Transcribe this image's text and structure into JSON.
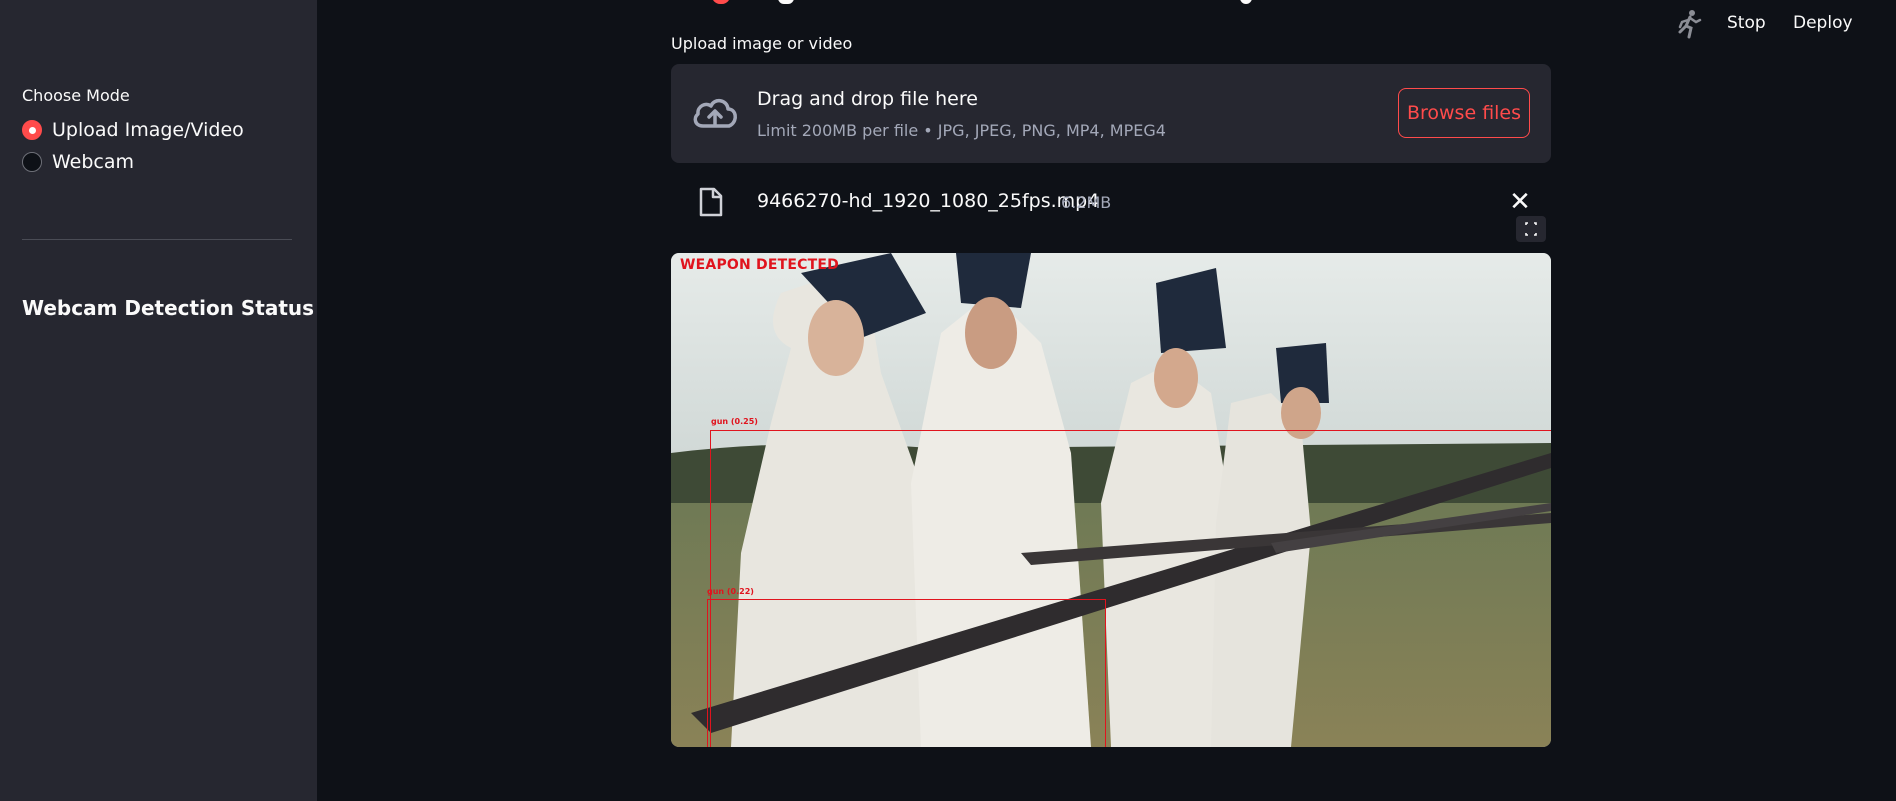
{
  "sidebar": {
    "mode_label": "Choose Mode",
    "options": [
      {
        "label": "Upload Image/Video",
        "selected": true
      },
      {
        "label": "Webcam",
        "selected": false
      }
    ],
    "status_heading": "Webcam Detection Status"
  },
  "toolbar": {
    "stop_label": "Stop",
    "deploy_label": "Deploy"
  },
  "uploader": {
    "label": "Upload image or video",
    "drop_title": "Drag and drop file here",
    "drop_subtitle": "Limit 200MB per file • JPG, JPEG, PNG, MP4, MPEG4",
    "browse_label": "Browse files"
  },
  "file": {
    "name": "9466270-hd_1920_1080_25fps.mp4",
    "size": "6.2MB"
  },
  "detection": {
    "banner": "WEAPON DETECTED",
    "boxes": [
      {
        "label": "gun  (0.25)"
      },
      {
        "label": "gun  (0.22)"
      }
    ]
  },
  "colors": {
    "accent": "#ff4b4b",
    "background": "#0e1117",
    "sidebar": "#262730",
    "detection": "#e0141e"
  }
}
